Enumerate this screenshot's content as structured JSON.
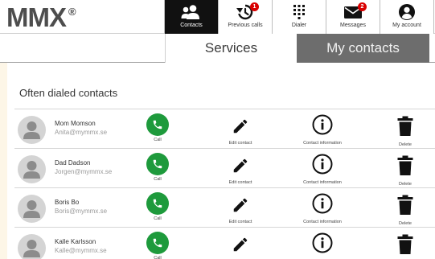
{
  "logo": {
    "text": "MMX",
    "mark": "®"
  },
  "nav": [
    {
      "label": "Contacts",
      "icon": "contacts-icon",
      "active": true
    },
    {
      "label": "Previous calls",
      "icon": "call-history-icon",
      "badge": "1"
    },
    {
      "label": "Dialer",
      "icon": "dialpad-icon"
    },
    {
      "label": "Messages",
      "icon": "envelope-icon",
      "badge": "2"
    },
    {
      "label": "My account",
      "icon": "account-icon"
    }
  ],
  "tabs": {
    "services": "Services",
    "my_contacts": "My contacts",
    "active": "my_contacts"
  },
  "section_title": "Often dialed contacts",
  "actions": {
    "call": "Call",
    "edit": "Edit contact",
    "info": "Contact information",
    "delete": "Delete"
  },
  "contacts": [
    {
      "name": "Mom  Momson",
      "email": "Anita@mymmx.se"
    },
    {
      "name": "Dad Dadson",
      "email": "Jorgen@mymmx.se"
    },
    {
      "name": "Boris Bo",
      "email": "Boris@mymmx.se"
    },
    {
      "name": "Kalle Karlsson",
      "email": "Kalle@mymmx.se"
    }
  ],
  "colors": {
    "call_green": "#1e9a3c",
    "badge_red": "#d90000",
    "active_tab": "#6d6d6d",
    "active_nav": "#111111"
  }
}
